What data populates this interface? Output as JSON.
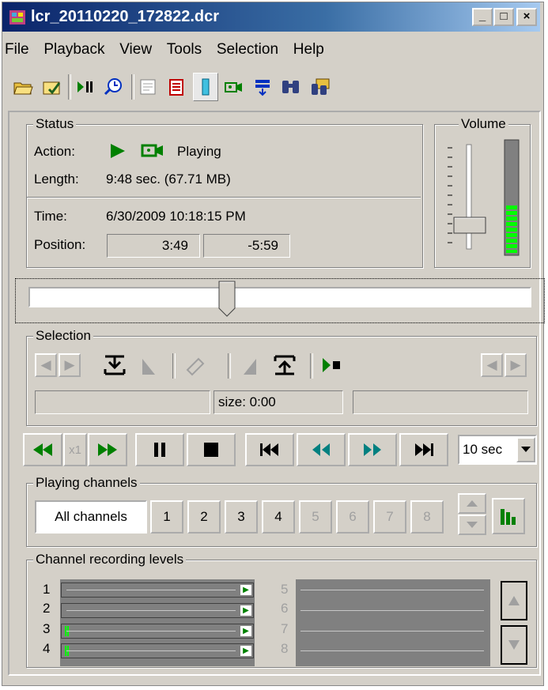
{
  "window": {
    "title": "lcr_20110220_172822.dcr"
  },
  "caption_buttons": {
    "minimize": "_",
    "maximize": "□",
    "close": "×"
  },
  "menu": [
    "File",
    "Playback",
    "View",
    "Tools",
    "Selection",
    "Help"
  ],
  "toolbar_icons": [
    "open-folder-icon",
    "open-file-icon",
    "play-pause-icon",
    "clock-search-icon",
    "properties-icon",
    "notes-icon",
    "channel-icon",
    "camera-icon",
    "export-icon",
    "binoculars-icon",
    "search-camera-icon"
  ],
  "status": {
    "group_label": "Status",
    "action_label": "Action:",
    "action_value": "Playing",
    "length_label": "Length:",
    "length_value": "9:48 sec. (67.71 MB)",
    "time_label": "Time:",
    "time_value": "6/30/2009 10:18:15 PM",
    "position_label": "Position:",
    "position_elapsed": "3:49",
    "position_remaining": "-5:59"
  },
  "volume": {
    "group_label": "Volume",
    "level": 0.4
  },
  "seek": {
    "position_fraction": 0.39
  },
  "selection": {
    "group_label": "Selection",
    "size_text": "size: 0:00"
  },
  "transport": {
    "speed_label": "x1",
    "step_value": "10 sec"
  },
  "playing_channels": {
    "group_label": "Playing channels",
    "all_label": "All channels",
    "channels": [
      "1",
      "2",
      "3",
      "4",
      "5",
      "6",
      "7",
      "8"
    ]
  },
  "recording_levels": {
    "group_label": "Channel recording levels",
    "left": [
      "1",
      "2",
      "3",
      "4"
    ],
    "right": [
      "5",
      "6",
      "7",
      "8"
    ]
  },
  "colors": {
    "accent_green": "#008000",
    "meter_green": "#00ff00",
    "teal": "#008080"
  }
}
